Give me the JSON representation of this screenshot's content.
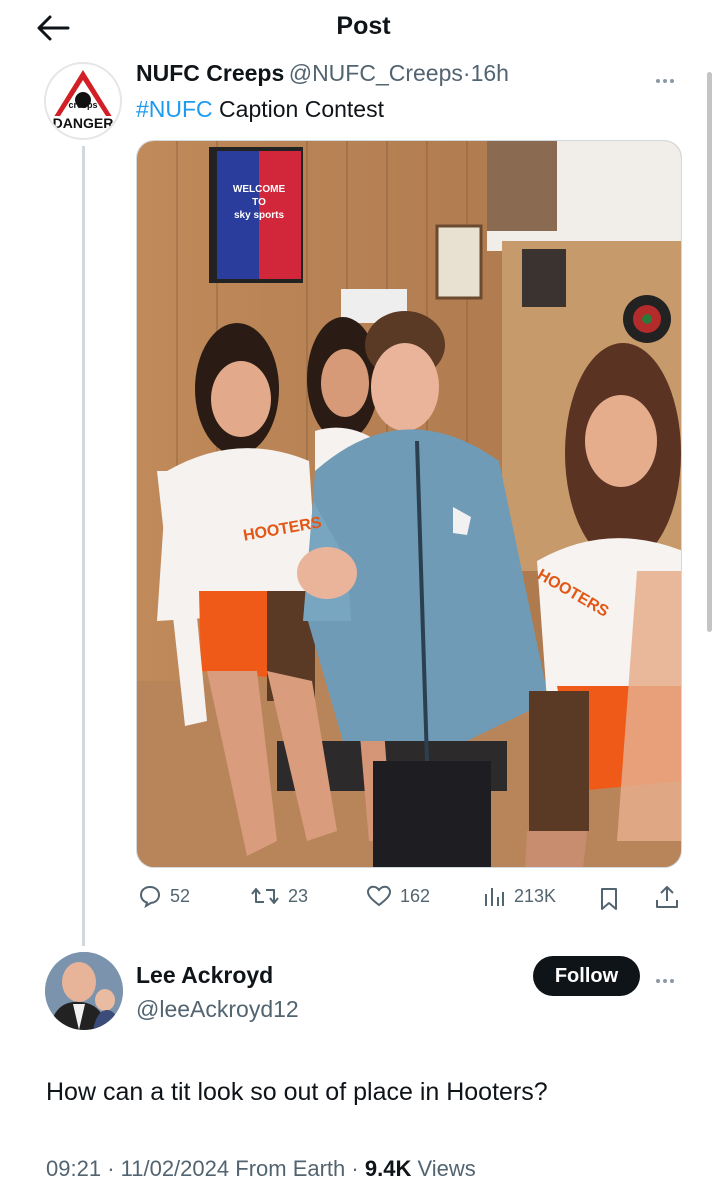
{
  "header": {
    "title": "Post"
  },
  "tweet": {
    "author_name": "NUFC Creeps",
    "author_handle": "@NUFC_Creeps",
    "separator": "·",
    "time": "16h",
    "hashtag": "#NUFC",
    "text": " Caption Contest",
    "avatar": {
      "top_text": "creeps",
      "bottom_text": "DANGER"
    },
    "photo": {
      "tv_lines": [
        "WELCOME",
        "TO",
        "sky sports"
      ],
      "shirt_text_1": "HOOTERS",
      "shirt_text_2": "HOOTERS"
    },
    "actions": {
      "replies": "52",
      "retweets": "23",
      "likes": "162",
      "views": "213K"
    }
  },
  "reply": {
    "author_name": "Lee Ackroyd",
    "author_handle": "@leeAckroyd12",
    "follow_label": "Follow",
    "text": "How can a tit look so out of place in Hooters?",
    "time": "09:21",
    "date": "11/02/2024",
    "source": "From Earth",
    "separator": "·",
    "views_count": "9.4K",
    "views_label": "Views"
  },
  "colors": {
    "accent": "#1d9bf0",
    "text": "#0f1419",
    "muted": "#536471",
    "danger_red": "#d21f26"
  }
}
